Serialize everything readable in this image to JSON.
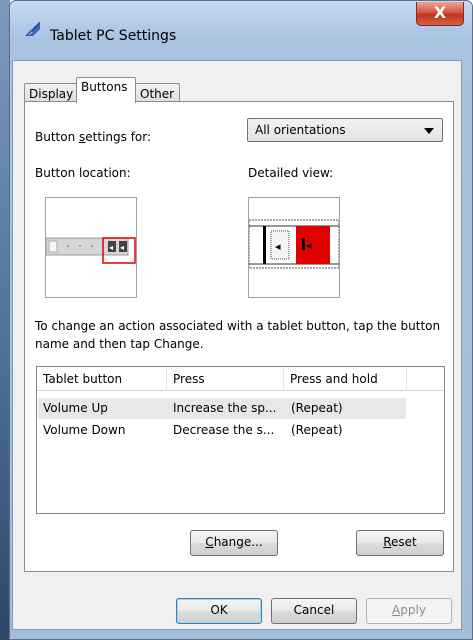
{
  "window": {
    "title": "Tablet PC Settings",
    "close_glyph": "X",
    "icon": "pen-icon"
  },
  "tabs": [
    {
      "label": "Display",
      "active": false
    },
    {
      "label": "Buttons",
      "active": true
    },
    {
      "label": "Other",
      "active": false
    }
  ],
  "buttons_tab": {
    "settings_for_label_pre": "Button ",
    "settings_for_label_mnemonic": "s",
    "settings_for_label_post": "ettings for:",
    "orientation_value": "All orientations",
    "location_label": "Button location:",
    "detailed_view_label": "Detailed view:",
    "instructions": "To change an action associated with a tablet button, tap the button name and then tap Change.",
    "list": {
      "columns": [
        "Tablet button",
        "Press",
        "Press and hold"
      ],
      "rows": [
        {
          "button": "Volume Up",
          "press": "Increase the sp...",
          "hold": "(Repeat)",
          "selected": true
        },
        {
          "button": "Volume Down",
          "press": "Decrease the s...",
          "hold": "(Repeat)",
          "selected": false
        }
      ]
    },
    "change_mnemonic": "C",
    "change_rest": "hange...",
    "reset_mnemonic": "R",
    "reset_rest": "eset"
  },
  "footer": {
    "ok_label": "OK",
    "cancel_label": "Cancel",
    "apply_mnemonic": "A",
    "apply_rest": "pply"
  },
  "colors": {
    "highlight_red": "#e00000",
    "selected_row": "#e8e8e8"
  }
}
